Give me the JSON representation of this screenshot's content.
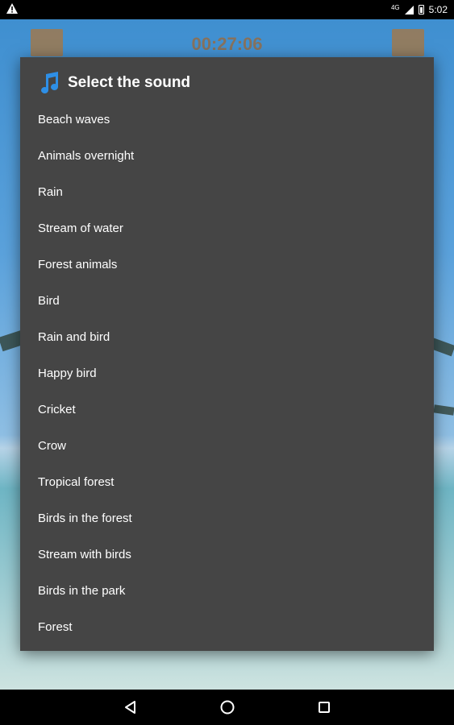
{
  "status_bar": {
    "network": "4G",
    "time": "5:02"
  },
  "background": {
    "timer": "00:27:06"
  },
  "dialog": {
    "title": "Select the sound",
    "items": [
      "Beach waves",
      "Animals overnight",
      "Rain",
      "Stream of water",
      "Forest animals",
      "Bird",
      "Rain and bird",
      "Happy bird",
      "Cricket",
      "Crow",
      "Tropical forest",
      "Birds in the forest",
      "Stream with birds",
      "Birds in the park",
      "Forest"
    ]
  },
  "icons": [
    "warning-icon",
    "signal-icon",
    "battery-icon",
    "music-note-icon",
    "back-icon",
    "home-icon",
    "recents-icon"
  ],
  "colors": {
    "dialog_bg": "#454545",
    "accent": "#c76f17",
    "note_icon": "#2e8fe6"
  }
}
